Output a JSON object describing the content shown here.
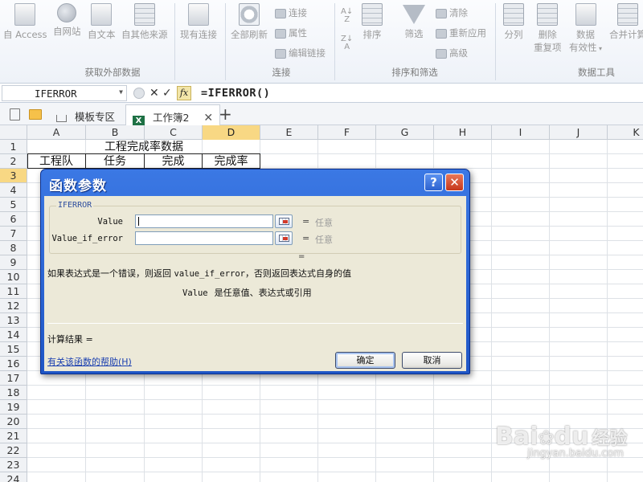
{
  "ribbon": {
    "buttons": {
      "access": "自 Access",
      "web": "自网站",
      "text": "自文本",
      "other": "自其他来源",
      "existing": "现有连接",
      "refresh_all": "全部刷新",
      "sort": "排序",
      "filter": "筛选",
      "split": "分列",
      "remove_dup_1": "删除",
      "remove_dup_2": "重复项",
      "validation_1": "数据",
      "validation_2": "有效性",
      "consolidate": "合并计算"
    },
    "small": {
      "connections": "连接",
      "properties": "属性",
      "edit_links": "编辑链接",
      "clear": "清除",
      "reapply": "重新应用",
      "advanced": "高级"
    },
    "groups": {
      "external": "获取外部数据",
      "connections": "连接",
      "sort_filter": "排序和筛选",
      "data_tools": "数据工具"
    }
  },
  "formula_bar": {
    "name_box": "IFERROR",
    "cancel": "✕",
    "enter": "✓",
    "fx": "fx",
    "formula": "=IFERROR()"
  },
  "tabs": {
    "template": "模板专区",
    "workbook": "工作簿2",
    "close": "✕",
    "new": "+"
  },
  "grid": {
    "columns": [
      "A",
      "B",
      "C",
      "D",
      "E",
      "F",
      "G",
      "H",
      "I",
      "J",
      "K"
    ],
    "rows": [
      "1",
      "2",
      "3",
      "4",
      "5",
      "6",
      "7",
      "8",
      "9",
      "10",
      "11",
      "12",
      "13",
      "14",
      "15",
      "16",
      "17",
      "18",
      "19",
      "20",
      "21",
      "22",
      "23",
      "24"
    ],
    "title_cell": "工程完成率数据",
    "headers": [
      "工程队",
      "任务",
      "完成",
      "完成率"
    ]
  },
  "dialog": {
    "title": "函数参数",
    "help": "?",
    "close": "✕",
    "function_name": "IFERROR",
    "args": [
      {
        "label": "Value",
        "value": "",
        "equals": "=",
        "result": "任意"
      },
      {
        "label": "Value_if_error",
        "value": "",
        "equals": "=",
        "result": "任意"
      }
    ],
    "result_equals": "=",
    "description_prefix": "如果表达式是一个错误，则返回 ",
    "description_code": "value_if_error",
    "description_suffix": "，否则返回表达式自身的值",
    "arg_desc_name": "Value",
    "arg_desc_text": "是任意值、表达式或引用",
    "calc_result": "计算结果 =",
    "help_link": "有关该函数的帮助(H)",
    "ok": "确定",
    "cancel": "取消"
  },
  "watermark": {
    "brand": "Bai",
    "brand2": "du",
    "brand3": "经验",
    "url": "jingyan.baidu.com"
  }
}
